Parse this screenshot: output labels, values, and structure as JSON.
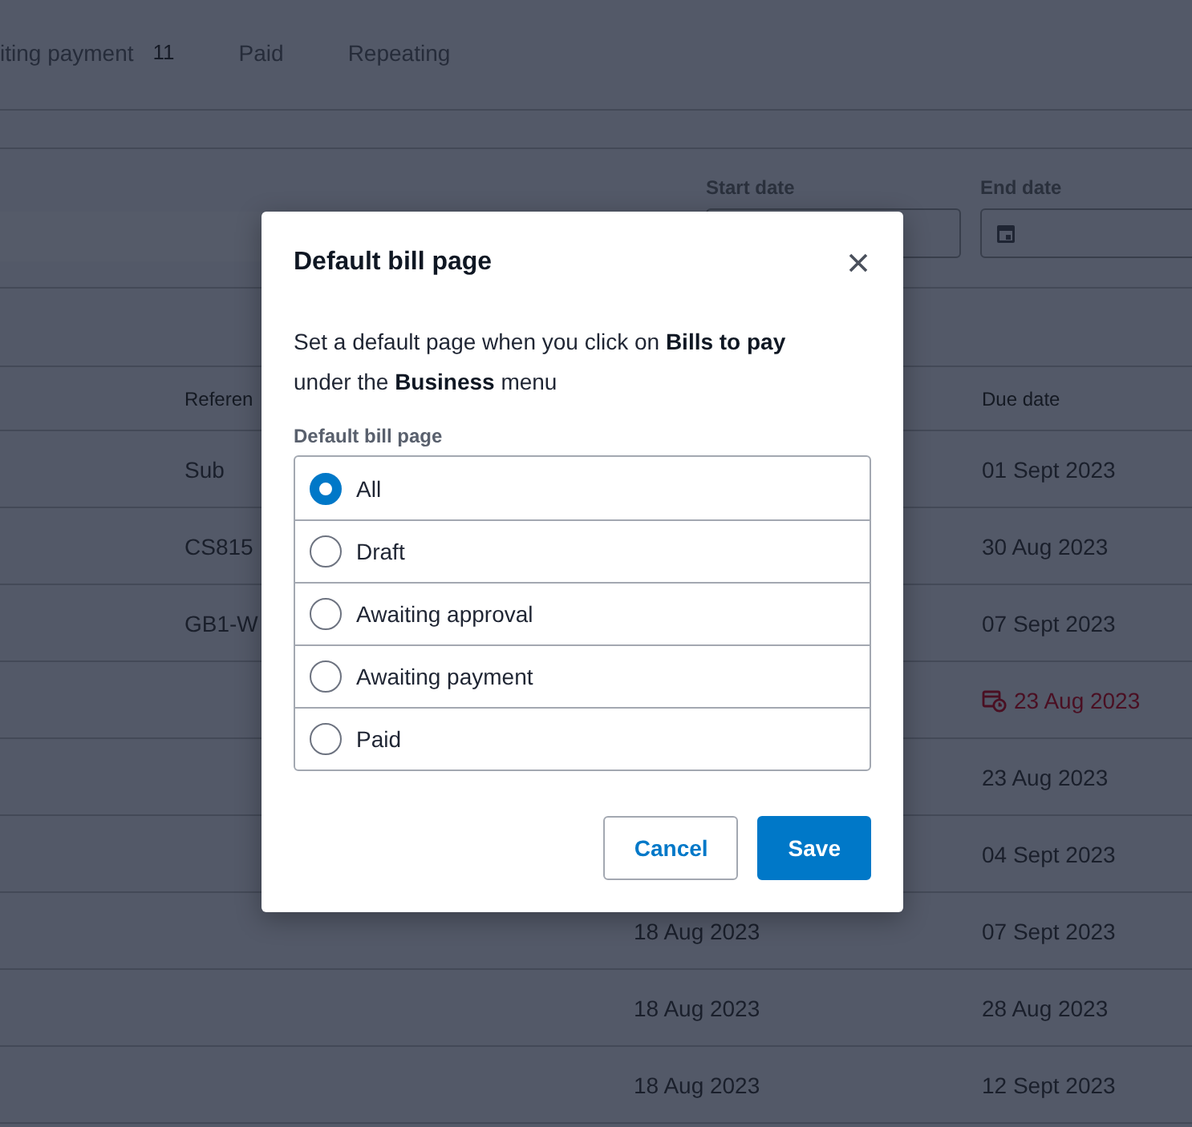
{
  "tabs": [
    {
      "label": "iting payment",
      "count": "11",
      "selected": false
    },
    {
      "label": "Paid",
      "selected": false
    },
    {
      "label": "Repeating",
      "selected": false
    }
  ],
  "filters": {
    "start_date": {
      "label": "Start date"
    },
    "end_date": {
      "label": "End date"
    }
  },
  "table": {
    "header": {
      "reference": "Referen",
      "due_date": "Due date"
    },
    "rows": [
      {
        "reference": "Sub",
        "due_date": "01 Sept 2023",
        "overdue": false
      },
      {
        "reference": "CS815",
        "due_date": "30 Aug 2023",
        "overdue": false
      },
      {
        "reference": "GB1-W",
        "due_date": "07 Sept 2023",
        "overdue": false
      },
      {
        "due_date": "23 Aug 2023",
        "overdue": true
      },
      {
        "due_date": "23 Aug 2023",
        "overdue": false
      },
      {
        "due_date": "04 Sept 2023",
        "overdue": false
      },
      {
        "date": "18 Aug 2023",
        "due_date": "07 Sept 2023",
        "overdue": false
      },
      {
        "date": "18 Aug 2023",
        "due_date": "28 Aug 2023",
        "overdue": false
      },
      {
        "date": "18 Aug 2023",
        "due_date": "12 Sept 2023",
        "overdue": false
      }
    ]
  },
  "dialog": {
    "title": "Default bill page",
    "description": "Set a default page when you click on **Bills to pay** under the **Business** menu",
    "field_label": "Default bill page",
    "options": [
      {
        "label": "All",
        "selected": true
      },
      {
        "label": "Draft",
        "selected": false
      },
      {
        "label": "Awaiting approval",
        "selected": false
      },
      {
        "label": "Awaiting payment",
        "selected": false
      },
      {
        "label": "Paid",
        "selected": false
      }
    ],
    "buttons": [
      {
        "label": "Cancel",
        "kind": "secondary"
      },
      {
        "label": "Save",
        "kind": "primary"
      }
    ]
  }
}
